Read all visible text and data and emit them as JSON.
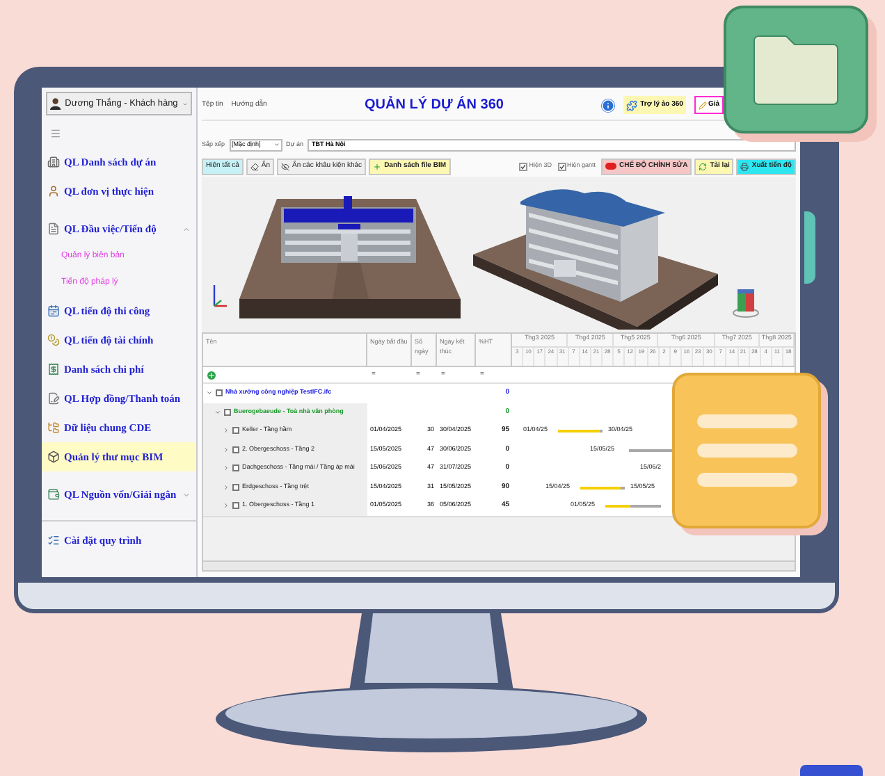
{
  "user": {
    "name": "Dương Thắng - Khách hàng"
  },
  "sidebar": {
    "items": [
      {
        "kind": "link",
        "label": "QL Danh sách dự án",
        "selected": false
      },
      {
        "kind": "link",
        "label": "QL đơn vị thực hiện",
        "selected": false
      },
      {
        "kind": "group",
        "label": "QL Đầu việc/Tiến độ",
        "selected": false,
        "expanded": true,
        "children": [
          {
            "label": "Quản lý biên bản",
            "selected": false
          },
          {
            "label": "Tiến độ pháp lý",
            "selected": false
          }
        ]
      },
      {
        "kind": "link",
        "label": "QL tiến độ thi công",
        "selected": false
      },
      {
        "kind": "link",
        "label": "QL tiến độ tài chính",
        "selected": false
      },
      {
        "kind": "link",
        "label": "Danh sách chi phí",
        "selected": false
      },
      {
        "kind": "link",
        "label": "QL Hợp đồng/Thanh toán",
        "selected": false
      },
      {
        "kind": "link",
        "label": "Dữ liệu chung CDE",
        "selected": false
      },
      {
        "kind": "link",
        "label": "Quản lý thư mục BIM",
        "selected": true
      },
      {
        "kind": "group",
        "label": "QL Nguồn vốn/Giải ngân",
        "selected": false,
        "expanded": false
      },
      {
        "kind": "link",
        "label": "Cài đặt quy trình",
        "selected": false
      }
    ]
  },
  "menu": [
    "Tệp tin",
    "Hướng dẫn"
  ],
  "title": "QUẢN LÝ DỰ ÁN 360",
  "header_buttons": [
    {
      "kind": "assistant",
      "label": "Trợ lý ảo 360"
    },
    {
      "kind": "edit",
      "label": "Giả"
    }
  ],
  "filters": {
    "sort_label": "Sắp xếp",
    "sort_value": "[Mặc định]",
    "project_label": "Dự án",
    "project_value": "TBT Hà Nội"
  },
  "toolbar": {
    "left": [
      {
        "kind": "show",
        "label": "Hiện tất cả"
      },
      {
        "kind": "hide",
        "label": "Ẩn"
      },
      {
        "kind": "hide-others",
        "label": "Ẩn các khâu kiện khác"
      },
      {
        "kind": "add",
        "label": "Danh sách file BIM"
      }
    ],
    "checkboxes": [
      {
        "label": "Hiện 3D",
        "checked": true
      },
      {
        "label": "Hiện gantt",
        "checked": true
      }
    ],
    "right": [
      {
        "kind": "toggle",
        "label": "CHẾ ĐỘ CHỈNH SỬA"
      },
      {
        "kind": "reload",
        "label": "Tải lại"
      },
      {
        "kind": "export",
        "label": "Xuất tiến độ"
      }
    ]
  },
  "table": {
    "columns": [
      "Tên",
      "Ngày bắt đầu",
      "Số ngày",
      "Ngày kết thúc",
      "%HT"
    ],
    "filter_row": [
      "=",
      "=",
      "=",
      "="
    ],
    "gantt": {
      "months": [
        "Thg3 2025",
        "Thg4 2025",
        "Thg5 2025",
        "Thg6 2025",
        "Thg7 2025",
        "Thg8 2025"
      ],
      "weeks": [
        "3",
        "10",
        "17",
        "24",
        "31",
        "7",
        "14",
        "21",
        "28",
        "5",
        "12",
        "19",
        "26",
        "2",
        "9",
        "16",
        "23",
        "30",
        "7",
        "14",
        "21",
        "28",
        "4",
        "11",
        "18"
      ]
    },
    "rows": [
      {
        "name": "Nhà xưởng công nghiệp TestIFC.ifc",
        "percent": "0",
        "expanded": true,
        "children": [
          {
            "name": "Buerogebaeude - Toà nhà văn phòng",
            "percent": "0",
            "expanded": true,
            "children": [
              {
                "name": "Keller - Tầng hầm",
                "start": "01/04/2025",
                "days": "30",
                "end": "30/04/2025",
                "percent": "95",
                "expanded": false,
                "bar": {
                  "start_label": "01/04/25",
                  "end_label": "30/04/25",
                  "level": 0.95
                }
              },
              {
                "name": "2. Obergeschoss - Tầng 2",
                "start": "15/05/2025",
                "days": "47",
                "end": "30/06/2025",
                "percent": "0",
                "expanded": false,
                "bar": {
                  "start_label": "15/05/25",
                  "level": 0
                }
              },
              {
                "name": "Dachgeschoss - Tầng mái / Tầng áp mái",
                "start": "15/06/2025",
                "days": "47",
                "end": "31/07/2025",
                "percent": "0",
                "expanded": false,
                "bar": {
                  "start_label": "15/06/2"
                }
              },
              {
                "name": "Erdgeschoss - Tầng trệt",
                "start": "15/04/2025",
                "days": "31",
                "end": "15/05/2025",
                "percent": "90",
                "expanded": false,
                "bar": {
                  "start_label": "15/04/25",
                  "end_label": "15/05/25",
                  "level": 0.9
                }
              },
              {
                "name": "1. Obergeschoss - Tầng 1",
                "start": "01/05/2025",
                "days": "36",
                "end": "05/06/2025",
                "percent": "45",
                "expanded": false,
                "bar": {
                  "start_label": "01/05/25",
                  "level": 0.45
                }
              }
            ]
          }
        ]
      }
    ]
  }
}
